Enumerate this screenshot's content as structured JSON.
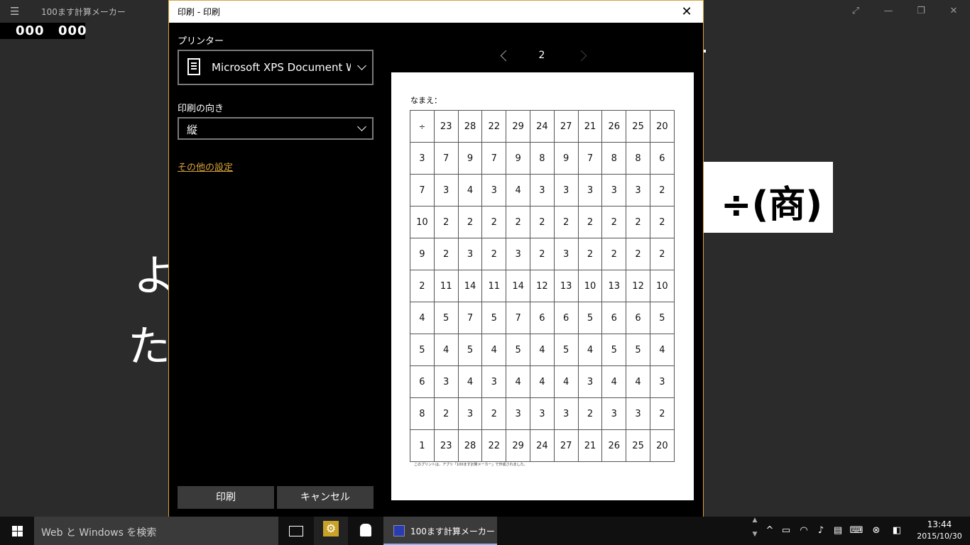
{
  "app": {
    "title": "100ます計算メーカー",
    "score_left": "000",
    "score_right": "000",
    "bg_char_1": "よ",
    "bg_char_2": "た",
    "operation_label": "÷(商)"
  },
  "dialog": {
    "title": "印刷 - 印刷",
    "printer_label": "プリンター",
    "printer_value": "Microsoft XPS Document Writer",
    "orientation_label": "印刷の向き",
    "orientation_value": "縦",
    "more_settings": "その他の設定",
    "print_button": "印刷",
    "cancel_button": "キャンセル",
    "page_number": "2"
  },
  "preview": {
    "name_label": "なまえ：",
    "operator": "÷",
    "top_row": [
      "23",
      "28",
      "22",
      "29",
      "24",
      "27",
      "21",
      "26",
      "25",
      "20"
    ],
    "rows": [
      {
        "head": "3",
        "cells": [
          "7",
          "9",
          "7",
          "9",
          "8",
          "9",
          "7",
          "8",
          "8",
          "6"
        ]
      },
      {
        "head": "7",
        "cells": [
          "3",
          "4",
          "3",
          "4",
          "3",
          "3",
          "3",
          "3",
          "3",
          "2"
        ]
      },
      {
        "head": "10",
        "cells": [
          "2",
          "2",
          "2",
          "2",
          "2",
          "2",
          "2",
          "2",
          "2",
          "2"
        ]
      },
      {
        "head": "9",
        "cells": [
          "2",
          "3",
          "2",
          "3",
          "2",
          "3",
          "2",
          "2",
          "2",
          "2"
        ]
      },
      {
        "head": "2",
        "cells": [
          "11",
          "14",
          "11",
          "14",
          "12",
          "13",
          "10",
          "13",
          "12",
          "10"
        ]
      },
      {
        "head": "4",
        "cells": [
          "5",
          "7",
          "5",
          "7",
          "6",
          "6",
          "5",
          "6",
          "6",
          "5"
        ]
      },
      {
        "head": "5",
        "cells": [
          "4",
          "5",
          "4",
          "5",
          "4",
          "5",
          "4",
          "5",
          "5",
          "4"
        ]
      },
      {
        "head": "6",
        "cells": [
          "3",
          "4",
          "3",
          "4",
          "4",
          "4",
          "3",
          "4",
          "4",
          "3"
        ]
      },
      {
        "head": "8",
        "cells": [
          "2",
          "3",
          "2",
          "3",
          "3",
          "3",
          "2",
          "3",
          "3",
          "2"
        ]
      },
      {
        "head": "1",
        "cells": [
          "23",
          "28",
          "22",
          "29",
          "24",
          "27",
          "21",
          "26",
          "25",
          "20"
        ]
      }
    ],
    "footer": "このプリントは、アプリ「100ます計算メーカー」で作成されました。"
  },
  "taskbar": {
    "search_placeholder": "Web と Windows を検索",
    "app_label": "100ます計算メーカー",
    "time": "13:44",
    "date": "2015/10/30"
  }
}
